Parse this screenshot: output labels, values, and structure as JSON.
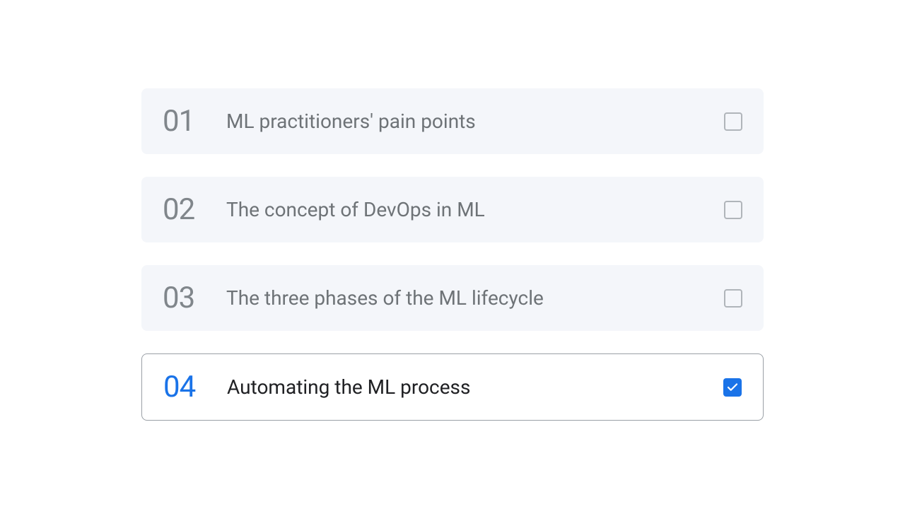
{
  "items": [
    {
      "number": "01",
      "title": "ML practitioners' pain points",
      "checked": false,
      "active": false
    },
    {
      "number": "02",
      "title": "The concept of DevOps in ML",
      "checked": false,
      "active": false
    },
    {
      "number": "03",
      "title": "The three phases of the ML lifecycle",
      "checked": false,
      "active": false
    },
    {
      "number": "04",
      "title": "Automating the ML process",
      "checked": true,
      "active": true
    }
  ]
}
